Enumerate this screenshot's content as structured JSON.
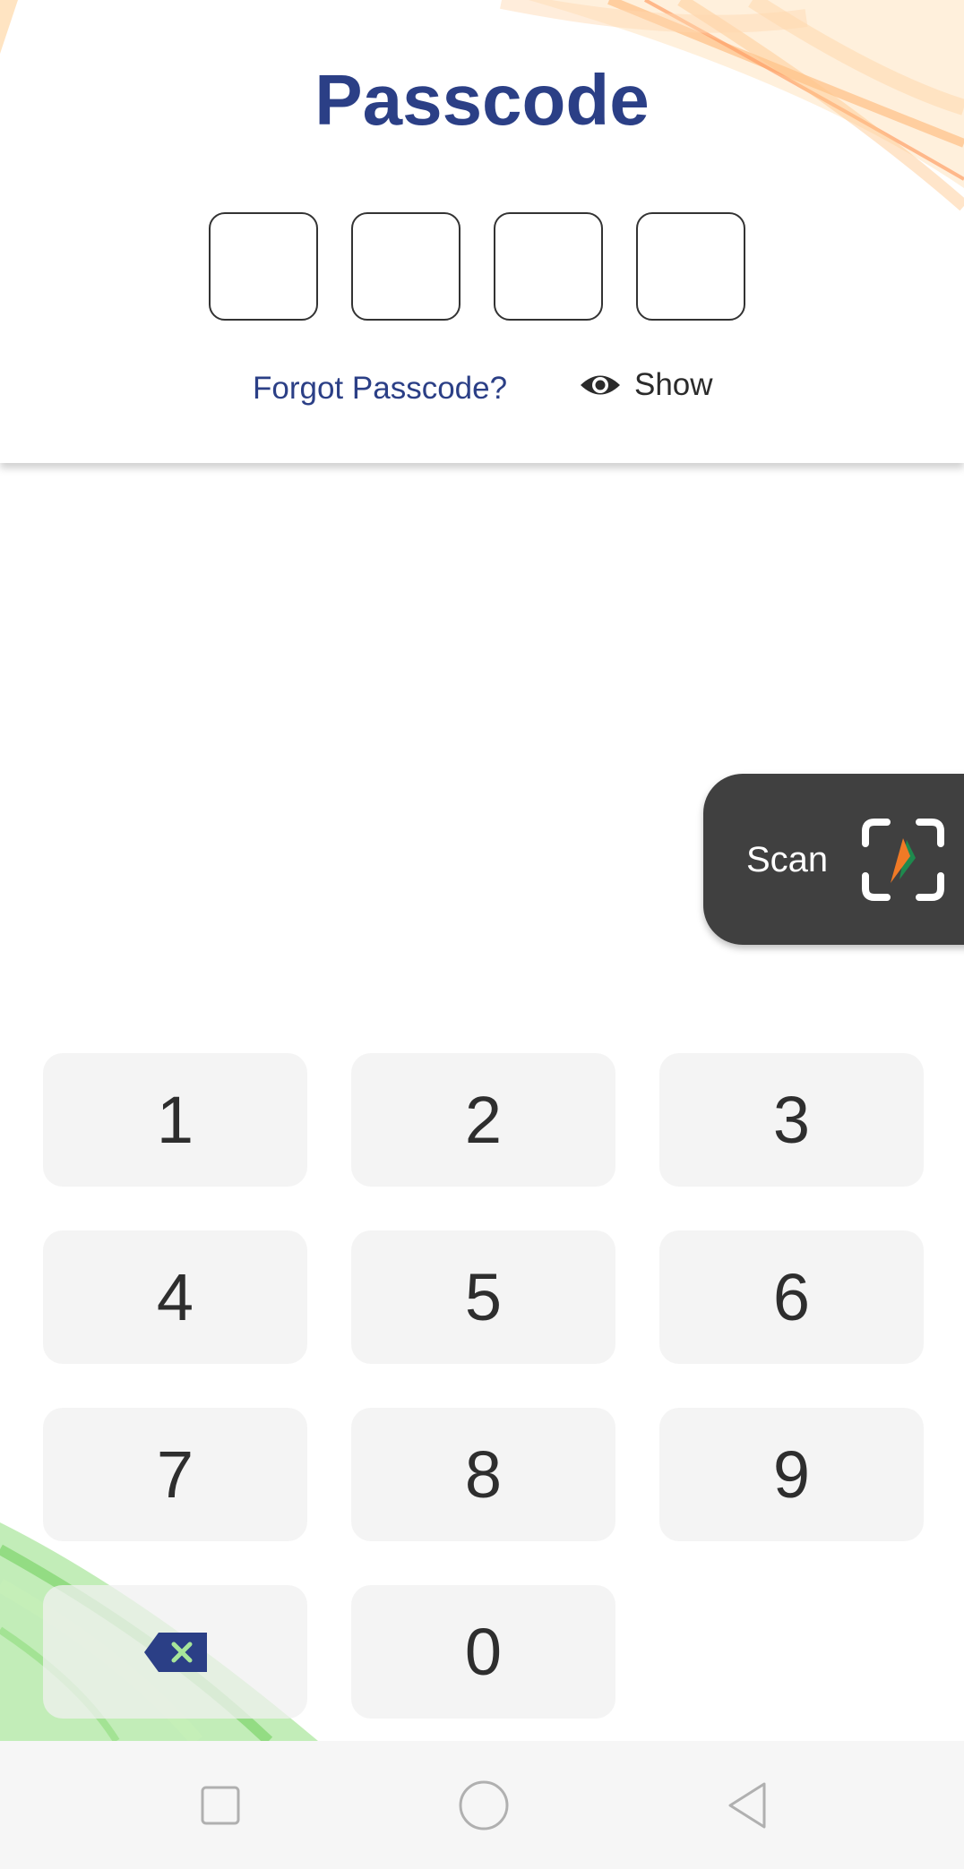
{
  "header": {
    "title": "Passcode",
    "pin_length": 4,
    "forgot_label": "Forgot Passcode?",
    "show_label": "Show"
  },
  "scan": {
    "label": "Scan"
  },
  "keypad": {
    "keys": [
      "1",
      "2",
      "3",
      "4",
      "5",
      "6",
      "7",
      "8",
      "9",
      "",
      "0",
      ""
    ]
  },
  "colors": {
    "title": "#2b3f86",
    "scan_background": "#404040",
    "key_background": "#f0f0f0",
    "backspace": "#2b3f86",
    "navbar": "#f6f6f6"
  },
  "icons": {
    "show": "eye-icon",
    "scan": "scan-frame-icon",
    "backspace": "backspace-icon",
    "nav": [
      "recent-apps-icon",
      "home-icon",
      "back-icon"
    ]
  }
}
